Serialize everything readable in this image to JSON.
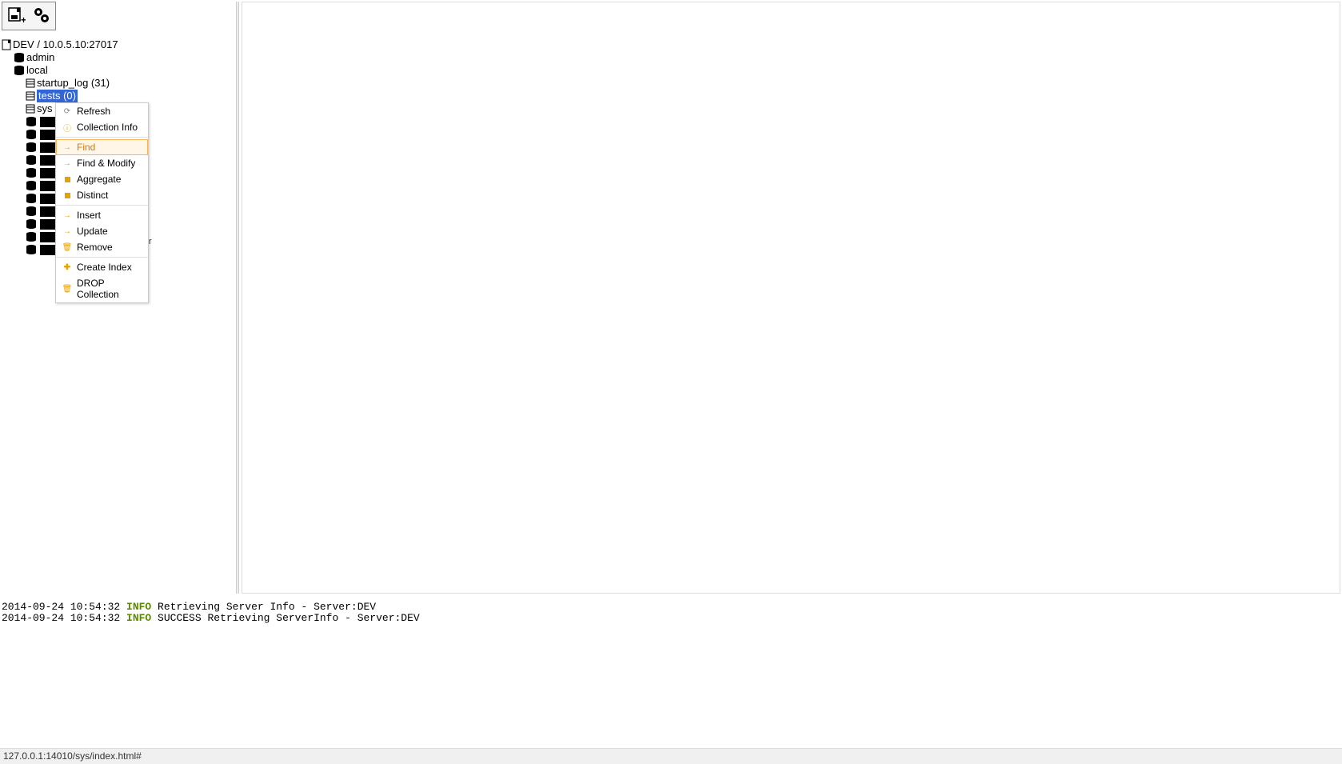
{
  "toolbar": {
    "add_server_icon": "disk-plus",
    "settings_icon": "gears"
  },
  "tree": {
    "server_label": "DEV / 10.0.5.10:27017",
    "databases": [
      {
        "name": "admin"
      },
      {
        "name": "local",
        "collections": [
          {
            "label": "startup_log (31)"
          },
          {
            "label": "tests (0)",
            "selected": true
          },
          {
            "label": "sys"
          }
        ]
      }
    ],
    "redacted_count": 11,
    "trailing_text": "r"
  },
  "context_menu": {
    "items": [
      {
        "icon": "refresh",
        "label": "Refresh"
      },
      {
        "icon": "info",
        "label": "Collection Info"
      },
      {
        "sep": true
      },
      {
        "icon": "arrow",
        "label": "Find",
        "hover": true
      },
      {
        "icon": "arrow",
        "label": "Find & Modify"
      },
      {
        "icon": "square",
        "label": "Aggregate"
      },
      {
        "icon": "square",
        "label": "Distinct"
      },
      {
        "sep": true
      },
      {
        "icon": "arrow",
        "label": "Insert"
      },
      {
        "icon": "arrow",
        "label": "Update"
      },
      {
        "icon": "trash",
        "label": "Remove"
      },
      {
        "sep": true
      },
      {
        "icon": "plus",
        "label": "Create Index"
      },
      {
        "icon": "trash",
        "label": "DROP Collection"
      }
    ]
  },
  "log": [
    {
      "ts": "2014-09-24 10:54:32",
      "level": "INFO",
      "msg": "Retrieving Server Info - Server:DEV"
    },
    {
      "ts": "2014-09-24 10:54:32",
      "level": "INFO",
      "msg": "SUCCESS Retrieving ServerInfo - Server:DEV"
    }
  ],
  "status_bar": {
    "text": "127.0.0.1:14010/sys/index.html#"
  }
}
